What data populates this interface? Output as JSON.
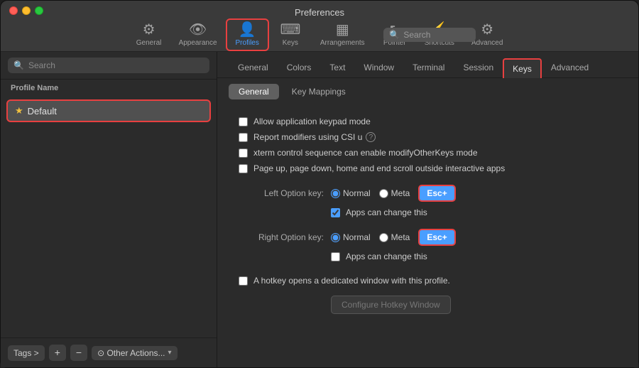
{
  "window": {
    "title": "Preferences"
  },
  "toolbar": {
    "items": [
      {
        "id": "general",
        "label": "General",
        "icon": "⚙"
      },
      {
        "id": "appearance",
        "label": "Appearance",
        "icon": "👁"
      },
      {
        "id": "profiles",
        "label": "Profiles",
        "icon": "👤",
        "active": true
      },
      {
        "id": "keys",
        "label": "Keys",
        "icon": "⌨"
      },
      {
        "id": "arrangements",
        "label": "Arrangements",
        "icon": "▦"
      },
      {
        "id": "pointer",
        "label": "Pointer",
        "icon": "↖"
      },
      {
        "id": "shortcuts",
        "label": "Shortcuts",
        "icon": "⚡"
      },
      {
        "id": "advanced",
        "label": "Advanced",
        "icon": "⚙"
      }
    ],
    "search_placeholder": "Search"
  },
  "left_panel": {
    "search_placeholder": "Search",
    "profile_list_header": "Profile Name",
    "profiles": [
      {
        "name": "Default",
        "is_default": true,
        "selected": true
      }
    ],
    "footer": {
      "tags_label": "Tags >",
      "add_label": "+",
      "remove_label": "−",
      "other_actions_label": "⊙ Other Actions...",
      "chevron": "▾"
    }
  },
  "right_panel": {
    "profile_tabs": [
      {
        "id": "general-tab",
        "label": "General"
      },
      {
        "id": "colors-tab",
        "label": "Colors"
      },
      {
        "id": "text-tab",
        "label": "Text"
      },
      {
        "id": "window-tab",
        "label": "Window"
      },
      {
        "id": "terminal-tab",
        "label": "Terminal"
      },
      {
        "id": "session-tab",
        "label": "Session"
      },
      {
        "id": "keys-tab",
        "label": "Keys",
        "active": true
      },
      {
        "id": "advanced-tab",
        "label": "Advanced"
      }
    ],
    "sub_tabs": [
      {
        "id": "general-sub",
        "label": "General",
        "active": true
      },
      {
        "id": "key-mappings-sub",
        "label": "Key Mappings"
      }
    ],
    "settings": {
      "checkboxes": [
        {
          "id": "allow-keypad",
          "label": "Allow application keypad mode",
          "checked": false
        },
        {
          "id": "report-modifiers",
          "label": "Report modifiers using CSI u",
          "checked": false,
          "help": true
        },
        {
          "id": "xterm-control",
          "label": "xterm control sequence can enable modifyOtherKeys mode",
          "checked": false
        },
        {
          "id": "page-scroll",
          "label": "Page up, page down, home and end scroll outside interactive apps",
          "checked": false
        }
      ],
      "left_option_key": {
        "label": "Left Option key:",
        "options": [
          {
            "value": "normal",
            "label": "Normal",
            "selected": true
          },
          {
            "value": "meta",
            "label": "Meta",
            "selected": false
          },
          {
            "value": "esc",
            "label": "Esc+",
            "selected": false,
            "button": true,
            "active": true
          }
        ],
        "apps_can_change": true,
        "apps_change_label": "Apps can change this"
      },
      "right_option_key": {
        "label": "Right Option key:",
        "options": [
          {
            "value": "normal",
            "label": "Normal",
            "selected": true
          },
          {
            "value": "meta",
            "label": "Meta",
            "selected": false
          },
          {
            "value": "esc",
            "label": "Esc+",
            "selected": false,
            "button": true,
            "active": true
          }
        ],
        "apps_can_change": false,
        "apps_change_label": "Apps can change this"
      },
      "hotkey": {
        "checkbox_label": "A hotkey opens a dedicated window with this profile.",
        "checked": false,
        "configure_label": "Configure Hotkey Window"
      }
    }
  }
}
